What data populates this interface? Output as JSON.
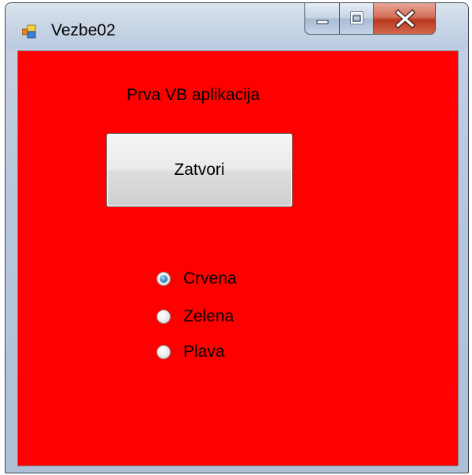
{
  "window": {
    "title": "Vezbe02",
    "icon": "form-app-icon",
    "controls": {
      "minimize_icon": "minimize-icon",
      "maximize_icon": "maximize-icon",
      "close_icon": "close-icon"
    },
    "client_background": "#ff0000"
  },
  "form": {
    "label": "Prva VB aplikacija",
    "close_button_label": "Zatvori",
    "radios": [
      {
        "label": "Crvena",
        "checked": true
      },
      {
        "label": "Zelena",
        "checked": false
      },
      {
        "label": "Plava",
        "checked": false
      }
    ]
  }
}
